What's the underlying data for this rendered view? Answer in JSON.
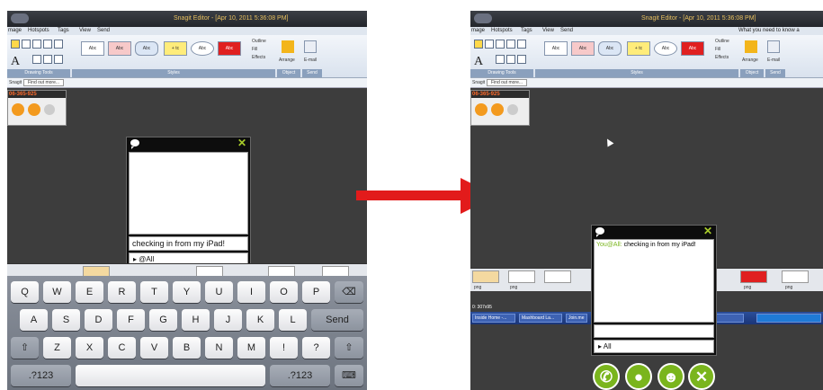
{
  "snagit": {
    "window_title": "Snagit Editor - [Apr 10, 2011 5:36:08 PM]",
    "right_title_fragment": "What you need to know a",
    "menu": [
      "mage",
      "Hotspots",
      "Tags",
      "View",
      "Send"
    ],
    "style_swatches": [
      "Abc",
      "Abc",
      "Abc",
      "+ tc",
      "Abc",
      "Abc"
    ],
    "ribbon_groups": [
      "Drawing Tools",
      "Styles",
      "Object",
      "Send"
    ],
    "effects": [
      "Outline",
      "Fill",
      "Effects"
    ],
    "arrange_label": "Arrange",
    "email_label": "E-mail",
    "quick_label": "Snagit",
    "quick_button": "Find out more...",
    "thumb_title": "06-365-925"
  },
  "left": {
    "chat_input": "checking in from my iPad!",
    "recipient": "▸ @All",
    "keyboard": {
      "row1": [
        "Q",
        "W",
        "E",
        "R",
        "T",
        "Y",
        "U",
        "I",
        "O",
        "P"
      ],
      "row2": [
        "A",
        "S",
        "D",
        "F",
        "G",
        "H",
        "J",
        "K",
        "L"
      ],
      "row3": [
        "Z",
        "X",
        "C",
        "V",
        "B",
        "N",
        "M"
      ],
      "return_label": "Send",
      "numbers_label": ".?123",
      "bang": "!",
      "question": "?"
    }
  },
  "right": {
    "chat_sender": "You@All:",
    "chat_message": "checking in from my iPad!",
    "recipient": "▸ All",
    "thumb_captions": [
      "png",
      "png",
      "png",
      "png"
    ],
    "status": "0: 307x95",
    "tasks": [
      "Inside Home -...",
      "Mashboard La...",
      "Join.me",
      "Snagit"
    ]
  },
  "colors": {
    "arrow": "#e21b1b",
    "accent_green": "#7ab51d",
    "close_x": "#a8cc2a"
  },
  "icons": [
    "chat-bubble-icon",
    "close-icon",
    "phone-icon",
    "chat-icon",
    "participants-icon",
    "end-icon",
    "backspace-icon",
    "shift-icon",
    "keyboard-hide-icon"
  ]
}
